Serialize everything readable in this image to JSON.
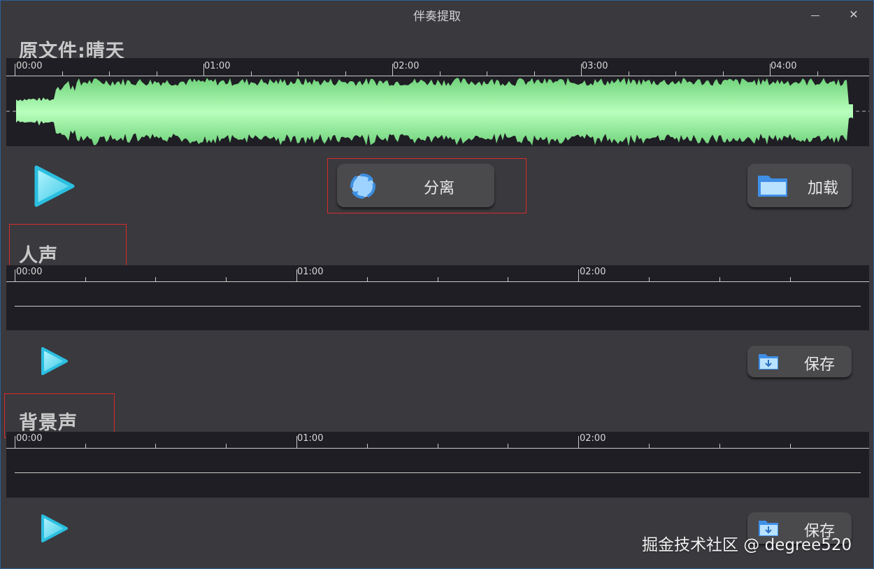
{
  "window": {
    "title": "伴奏提取",
    "minimize": "—",
    "close": "✕"
  },
  "original": {
    "label": "原文件:晴天",
    "ticks": [
      "00:00",
      "01:00",
      "02:00",
      "03:00",
      "04:00"
    ]
  },
  "controls": {
    "separate_label": "分离",
    "load_label": "加载"
  },
  "vocals": {
    "label": "人声",
    "ticks": [
      "00:00",
      "01:00",
      "02:00"
    ],
    "save_label": "保存"
  },
  "background": {
    "label": "背景声",
    "ticks": [
      "00:00",
      "01:00",
      "02:00"
    ],
    "save_label": "保存"
  },
  "watermark": "掘金技术社区 @ degree520",
  "colors": {
    "accent_play": "#3fd0ea",
    "wave_green": "#9ff3a4",
    "red_annotation": "#d62b2b",
    "window_bg": "#3a393e",
    "panel_bg": "#1f1e24"
  }
}
